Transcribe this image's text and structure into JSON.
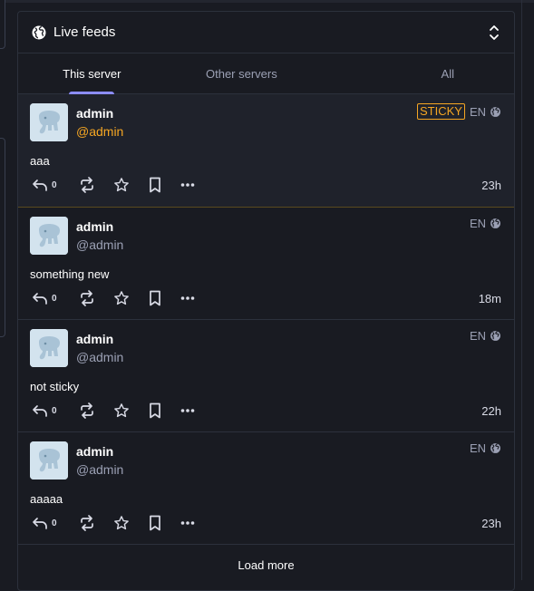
{
  "column": {
    "title": "Live feeds",
    "icon": "globe-icon",
    "collapse_icon": "chevron-up-down-icon"
  },
  "tabs": [
    {
      "label": "This server",
      "active": true
    },
    {
      "label": "Other servers",
      "active": false
    },
    {
      "label": "All",
      "active": false
    }
  ],
  "statuses": [
    {
      "display_name": "admin",
      "acct": "@admin",
      "sticky": true,
      "sticky_label": "STICKY",
      "lang": "EN",
      "content": "aaa",
      "replies": "0",
      "time": "23h"
    },
    {
      "display_name": "admin",
      "acct": "@admin",
      "sticky": false,
      "lang": "EN",
      "content": "something new",
      "replies": "0",
      "time": "18m"
    },
    {
      "display_name": "admin",
      "acct": "@admin",
      "sticky": false,
      "lang": "EN",
      "content": "not sticky",
      "replies": "0",
      "time": "22h"
    },
    {
      "display_name": "admin",
      "acct": "@admin",
      "sticky": false,
      "lang": "EN",
      "content": "aaaaa",
      "replies": "0",
      "time": "23h"
    }
  ],
  "load_more": "Load more",
  "colors": {
    "background": "#191b22",
    "accent": "#8c8dff",
    "sticky": "#f5a623",
    "secondary_text": "#9ba0b4"
  }
}
